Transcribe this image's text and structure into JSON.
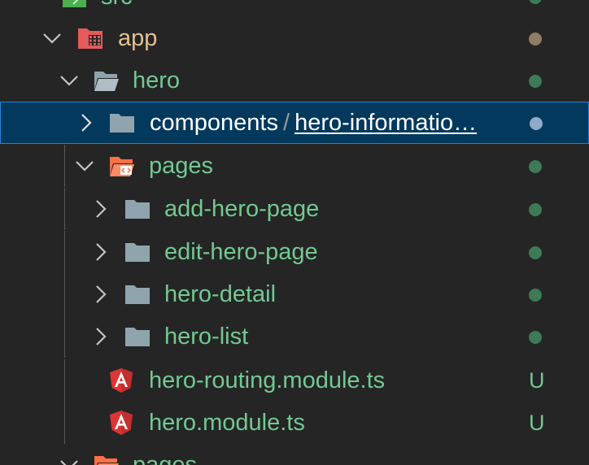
{
  "tree": {
    "src": {
      "label": "src"
    },
    "app": {
      "label": "app",
      "status_color": "#8f7c62"
    },
    "hero": {
      "label": "hero",
      "status_color": "#3e7a54"
    },
    "components": {
      "label": "components",
      "separator": "/",
      "sublabel": "hero-informatio…",
      "status_color": "#8fa9c9"
    },
    "pages": {
      "label": "pages",
      "status_color": "#3e7a54"
    },
    "add_hero_page": {
      "label": "add-hero-page",
      "status_color": "#3e7a54"
    },
    "edit_hero_page": {
      "label": "edit-hero-page",
      "status_color": "#3e7a54"
    },
    "hero_detail": {
      "label": "hero-detail",
      "status_color": "#3e7a54"
    },
    "hero_list": {
      "label": "hero-list",
      "status_color": "#3e7a54"
    },
    "hero_routing": {
      "label": "hero-routing.module.ts",
      "git_status": "U"
    },
    "hero_module": {
      "label": "hero.module.ts",
      "git_status": "U"
    },
    "pages_bottom": {
      "label": "pages"
    }
  },
  "icons": {
    "folder_plain": "folder-icon",
    "folder_app": "app-folder-icon",
    "folder_pages": "pages-folder-icon",
    "file_angular": "angular-icon",
    "folder_src": "src-folder-icon"
  },
  "colors": {
    "background": "#252526",
    "selection_background": "#04395e",
    "selection_border": "#2a7fd4",
    "untracked_text": "#73c991",
    "modified_folder_text": "#e2c08d",
    "folder_icon": "#90a4ae",
    "angular_red": "#dd3434"
  }
}
